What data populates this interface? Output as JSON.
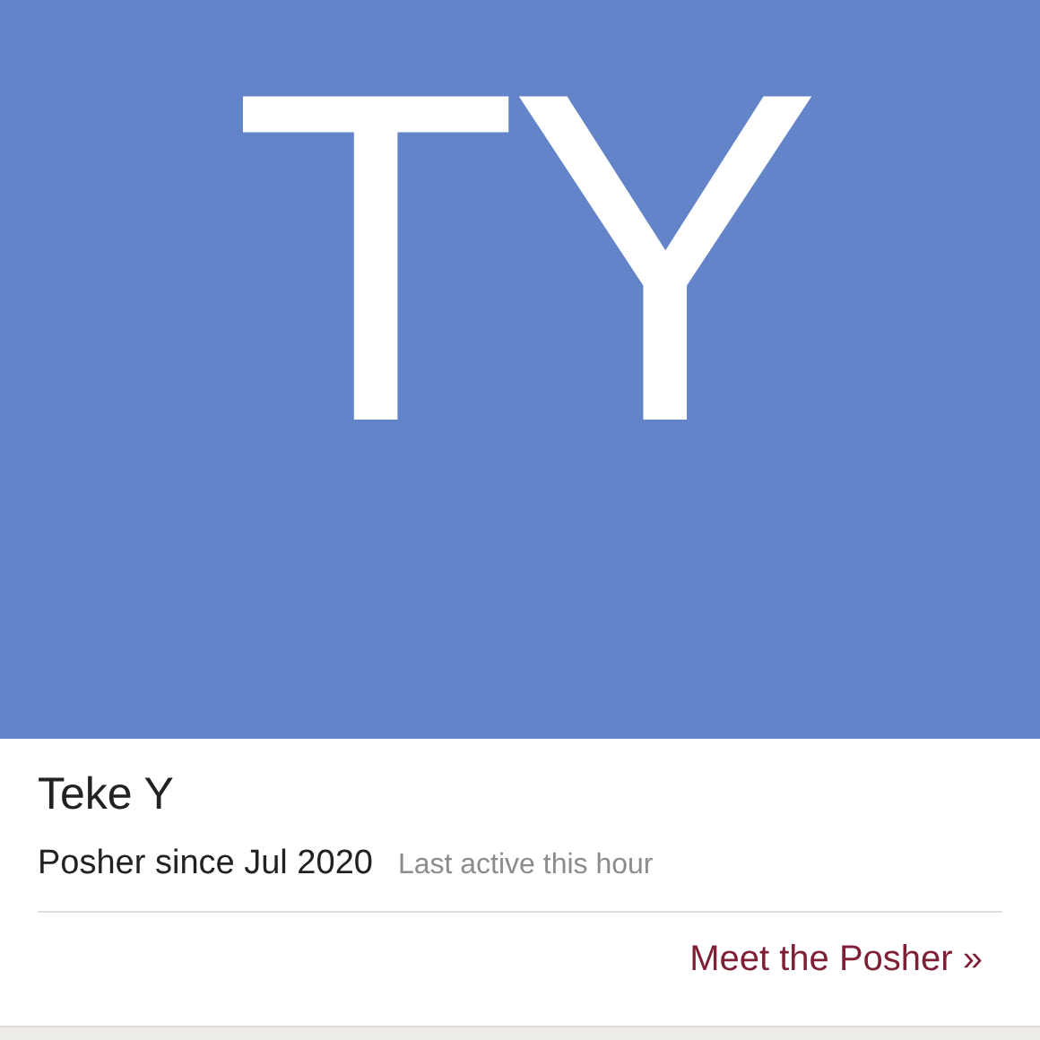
{
  "avatar": {
    "initials": "TY"
  },
  "profile": {
    "name": "Teke Y",
    "member_since": "Posher since Jul 2020",
    "last_active": "Last active this hour"
  },
  "link": {
    "label": "Meet the Posher »"
  }
}
